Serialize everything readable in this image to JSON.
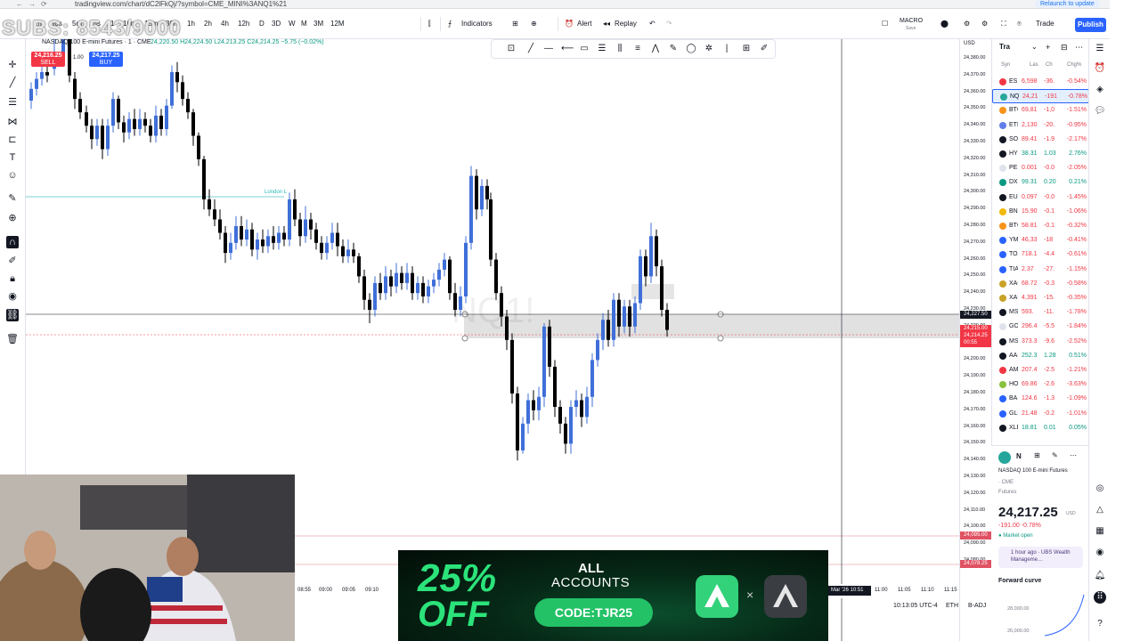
{
  "browser": {
    "url": "tradingview.com/chart/dC2lFkQj/?symbol=CME_MINI%3ANQ1%21",
    "relaunch_label": "Relaunch to update"
  },
  "overlay_text": "SUBS: 8543/9000",
  "toolbar": {
    "timeframes": [
      "1m",
      "30s",
      "5m",
      "15s",
      "1",
      "10m",
      "15m",
      "30m",
      "1h",
      "2h",
      "4h",
      "12h",
      "D",
      "3D",
      "W",
      "M",
      "3M",
      "12M"
    ],
    "indicators_label": "Indicators",
    "alert_label": "Alert",
    "replay_label": "Replay",
    "macro_label": "MACRO",
    "macro_sub": "Save",
    "trade_label": "Trade",
    "publish_label": "Publish"
  },
  "chart": {
    "symbol_title": "NASDAQ 100 E-mini Futures · 1 · CME",
    "ohlc": "24,220.50  H24,224.50  L24,213.25  C24,214.25  −5.75 (−0.02%)",
    "sell_price": "24,216.25",
    "sell_label": "SELL",
    "buy_price": "24,217.25",
    "buy_label": "BUY",
    "spread": "1.00",
    "watermark": "NQ1!",
    "session_label": "London L"
  },
  "price_axis": {
    "currency": "USD",
    "labels": [
      "24,380.00",
      "24,370.00",
      "24,360.00",
      "24,350.00",
      "24,340.00",
      "24,330.00",
      "24,320.00",
      "24,310.00",
      "24,300.00",
      "24,290.00",
      "24,280.00",
      "24,270.00",
      "24,260.00",
      "24,250.00",
      "24,240.00",
      "24,230.00",
      "24,220.00",
      "24,210.00",
      "24,200.00",
      "24,190.00",
      "24,180.00",
      "24,170.00",
      "24,160.00",
      "24,150.00",
      "24,140.00",
      "24,130.00",
      "24,120.00",
      "24,110.00",
      "24,100.00",
      "24,090.00",
      "24,080.00"
    ],
    "crosshair_price": "24,227.50",
    "last_price": "24,215.00",
    "last_price2": "24,214.25",
    "countdown": "00:55",
    "level1": "24,095.00",
    "level2": "24,078.25"
  },
  "time_axis": {
    "labels": [
      "08:55",
      "09:00",
      "09:05",
      "09:10",
      "11:00",
      "11:05",
      "11:10",
      "11:15"
    ],
    "cursor_date": "Mar '26  10:51",
    "clock": "10:13:05 UTC-4",
    "eth": "ETH",
    "badj": "B-ADJ"
  },
  "watchlist": {
    "title": "Tra",
    "columns": [
      "Syn",
      "Las",
      "Ch",
      "Chg%"
    ],
    "rows": [
      {
        "sym": "ES",
        "last": "6,598",
        "chg": "-36.",
        "pct": "-0.54%",
        "color": "#f23645",
        "neg": true
      },
      {
        "sym": "NQ",
        "last": "24,21",
        "chg": "-191",
        "pct": "-0.78%",
        "color": "#26a69a",
        "neg": true
      },
      {
        "sym": "BTC",
        "last": "69,81",
        "chg": "-1,0",
        "pct": "-1.51%",
        "color": "#f7931a",
        "neg": true
      },
      {
        "sym": "ETH",
        "last": "2,130",
        "chg": "-20.",
        "pct": "-0.95%",
        "color": "#627eea",
        "neg": true
      },
      {
        "sym": "SOL",
        "last": "89.41",
        "chg": "-1.9",
        "pct": "-2.17%",
        "color": "#131722",
        "neg": true
      },
      {
        "sym": "HYPE",
        "last": "38.31",
        "chg": "1.03",
        "pct": "2.76%",
        "color": "#131722",
        "neg": false
      },
      {
        "sym": "PEPE",
        "last": "0.001",
        "chg": "-0.0",
        "pct": "-2.05%",
        "color": "#e0e3eb",
        "neg": true
      },
      {
        "sym": "DXY",
        "last": "99.31",
        "chg": "0.20",
        "pct": "0.21%",
        "color": "#089981",
        "neg": false
      },
      {
        "sym": "EUR",
        "last": "0.097",
        "chg": "-0.0",
        "pct": "-1.45%",
        "color": "#131722",
        "neg": true
      },
      {
        "sym": "BNB",
        "last": "15.90",
        "chg": "-0.1",
        "pct": "-1.06%",
        "color": "#f0b90b",
        "neg": true
      },
      {
        "sym": "BTC2",
        "last": "58.81",
        "chg": "-0.1",
        "pct": "-0.32%",
        "color": "#f7931a",
        "neg": true
      },
      {
        "sym": "YM",
        "last": "46,33",
        "chg": "-18",
        "pct": "-0.41%",
        "color": "#2962ff",
        "neg": true
      },
      {
        "sym": "TON",
        "last": "718.1",
        "chg": "-4.4",
        "pct": "-0.61%",
        "color": "#2962ff",
        "neg": true
      },
      {
        "sym": "TIA",
        "last": "2.37",
        "chg": "-27.",
        "pct": "-1.15%",
        "color": "#2962ff",
        "neg": true
      },
      {
        "sym": "XAG",
        "last": "68.72",
        "chg": "-0.3",
        "pct": "-0.58%",
        "color": "#c9a227",
        "neg": true
      },
      {
        "sym": "XAU",
        "last": "4,391",
        "chg": "-15.",
        "pct": "-0.35%",
        "color": "#c9a227",
        "neg": true
      },
      {
        "sym": "MSTR",
        "last": "593.",
        "chg": "-11.",
        "pct": "-1.78%",
        "color": "#131722",
        "neg": true
      },
      {
        "sym": "GOOG",
        "last": "296.4",
        "chg": "-5.5",
        "pct": "-1.84%",
        "color": "#e0e3eb",
        "neg": true
      },
      {
        "sym": "MSFT",
        "last": "373.3",
        "chg": "-9.6",
        "pct": "-2.52%",
        "color": "#131722",
        "neg": true
      },
      {
        "sym": "AAPL",
        "last": "252.3",
        "chg": "1.28",
        "pct": "0.51%",
        "color": "#131722",
        "neg": false
      },
      {
        "sym": "AMZN",
        "last": "207.4",
        "chg": "-2.5",
        "pct": "-1.21%",
        "color": "#f23645",
        "neg": true
      },
      {
        "sym": "HOOD",
        "last": "69.86",
        "chg": "-2.6",
        "pct": "-3.63%",
        "color": "#89c23f",
        "neg": true
      },
      {
        "sym": "BA",
        "last": "124.6",
        "chg": "-1.3",
        "pct": "-1.09%",
        "color": "#2962ff",
        "neg": true
      },
      {
        "sym": "GLD",
        "last": "21.48",
        "chg": "-0.2",
        "pct": "-1.01%",
        "color": "#2962ff",
        "neg": true
      },
      {
        "sym": "XLE",
        "last": "18.81",
        "chg": "0.01",
        "pct": "0.05%",
        "color": "#131722",
        "neg": false
      }
    ]
  },
  "detail": {
    "sym": "N",
    "name": "NASDAQ 100 E-mini Futures",
    "exchange": "· CME",
    "type": "Futures",
    "price": "24,217.25",
    "currency": "USD",
    "change": "-191.00  -0.78%",
    "status": "● Market open",
    "news": "1 hour ago · UBS Wealth Manageme…",
    "forward_curve": "Forward curve",
    "fc1": "28,000.00",
    "fc2": "26,000.00"
  },
  "ad": {
    "percent": "25%",
    "off": "OFF",
    "all": "ALL",
    "accounts": "ACCOUNTS",
    "code": "CODE:TJR25",
    "x": "×"
  },
  "colors": {
    "bull": "#3f6fd8",
    "bear": "#000000",
    "zone": "#d9d9d9",
    "accent": "#2962ff"
  }
}
